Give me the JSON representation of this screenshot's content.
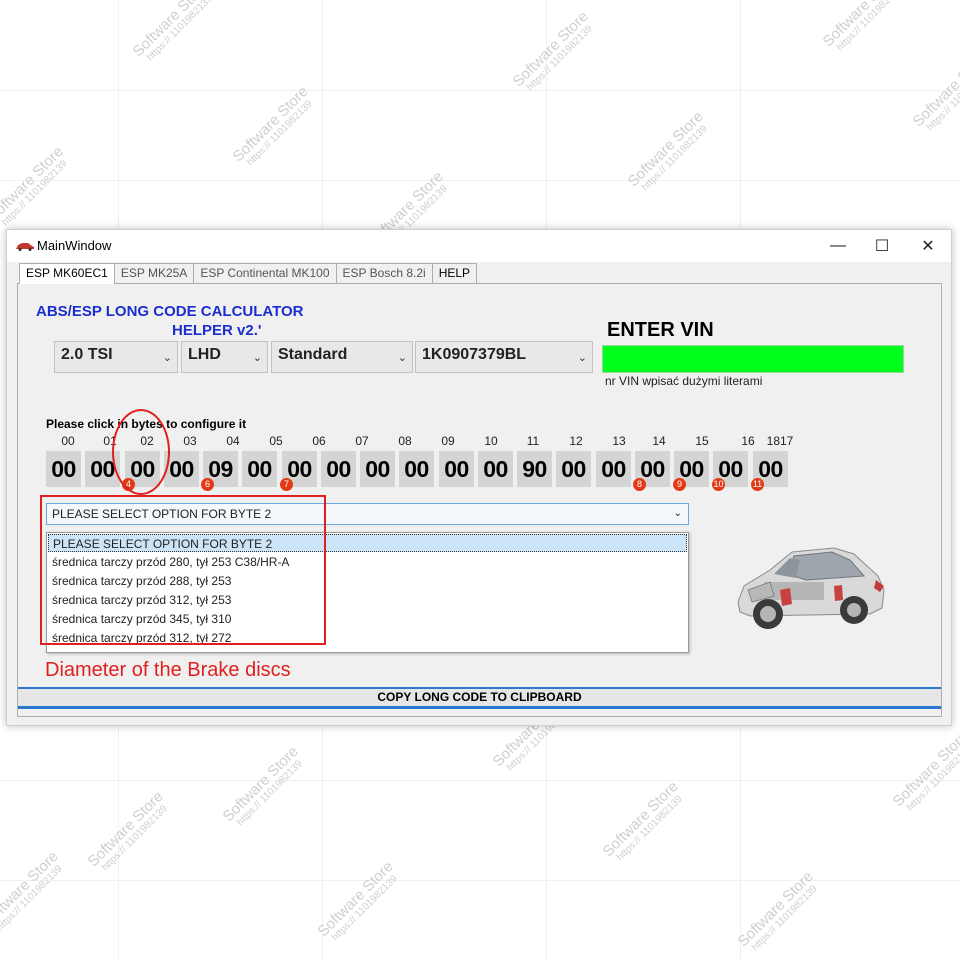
{
  "window": {
    "title": "MainWindow",
    "minimize_glyph": "—",
    "maximize_glyph": "☐",
    "close_glyph": "✕"
  },
  "tabs": [
    {
      "label": "ESP MK60EC1",
      "active": true
    },
    {
      "label": "ESP MK25A",
      "active": false
    },
    {
      "label": "ESP Continental MK100",
      "active": false
    },
    {
      "label": "ESP Bosch 8.2i",
      "active": false
    },
    {
      "label": "HELP",
      "active": false
    }
  ],
  "header": {
    "title_line1": "ABS/ESP LONG CODE CALCULATOR",
    "title_line2": "HELPER v2.'"
  },
  "selectors": {
    "engine": "2.0 TSI",
    "steering": "LHD",
    "variant": "Standard",
    "part_number": "1K0907379BL"
  },
  "vin": {
    "title": "ENTER VIN",
    "value": "",
    "hint": "nr VIN wpisać dużymi literami"
  },
  "bytes": {
    "hint": "Please click in bytes to configure it",
    "indices": [
      "00",
      "01",
      "02",
      "03",
      "04",
      "05",
      "06",
      "07",
      "08",
      "09",
      "10",
      "11",
      "12",
      "13",
      "14",
      "15",
      "16",
      "1817"
    ],
    "values": [
      "00",
      "00",
      "00",
      "00",
      "09",
      "00",
      "00",
      "00",
      "00",
      "00",
      "00",
      "00",
      "90",
      "00",
      "00",
      "00",
      "00",
      "00",
      "00"
    ],
    "badges": [
      "4",
      "6",
      "7",
      "8",
      "9",
      "10",
      "11"
    ]
  },
  "byte_option": {
    "selected": "PLEASE SELECT OPTION  FOR BYTE 2",
    "options": [
      "PLEASE SELECT OPTION  FOR BYTE 2",
      "średnica tarczy przód 280, tył 253 C38/HR-A",
      "średnica tarczy przód 288, tył 253",
      "średnica tarczy przód 312, tył 253",
      "średnica tarczy przód 345, tył 310",
      "średnica tarczy przód 312, tył 272"
    ]
  },
  "annotation": {
    "caption": "Diameter of the Brake discs"
  },
  "copy_button": {
    "label": "COPY LONG CODE TO CLIPBOARD"
  },
  "watermark": {
    "line1": "Software Store",
    "line2": "https:// 1101982139"
  },
  "colors": {
    "accent_blue": "#1b2ecf",
    "vin_green": "#00ff1a",
    "annotation_red": "#e02020",
    "badge_red": "#e23a17"
  }
}
